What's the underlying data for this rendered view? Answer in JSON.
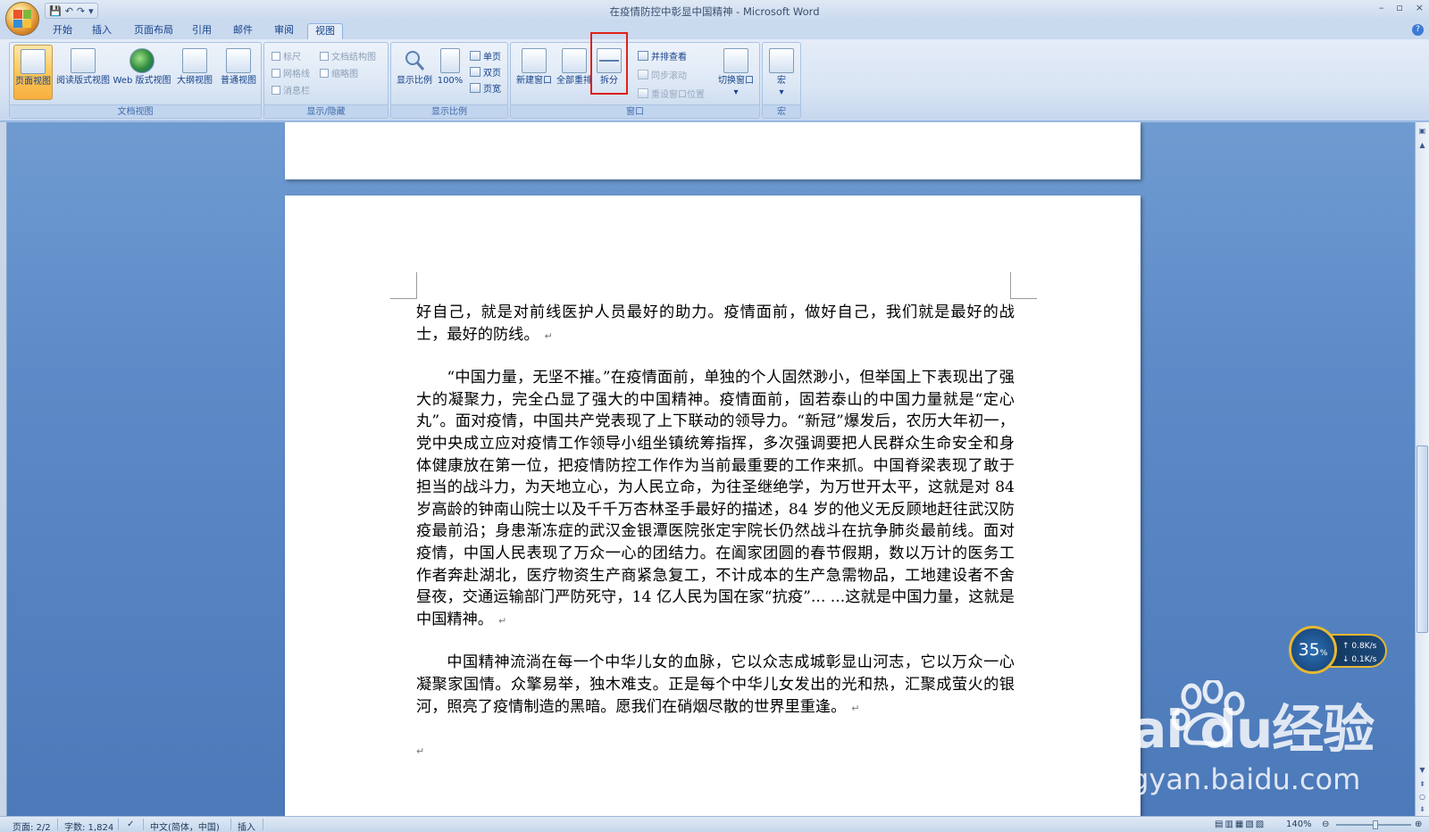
{
  "window": {
    "title": "在疫情防控中彰显中国精神 - Microsoft Word",
    "controls": [
      "–",
      "▫",
      "×"
    ]
  },
  "qat": {
    "save": "💾",
    "undo": "↶",
    "redo": "↷",
    "more": "▾"
  },
  "tabs": [
    {
      "label": "开始"
    },
    {
      "label": "插入"
    },
    {
      "label": "页面布局"
    },
    {
      "label": "引用"
    },
    {
      "label": "邮件"
    },
    {
      "label": "审阅"
    },
    {
      "label": "视图"
    }
  ],
  "ribbon": {
    "groups": {
      "doc_views": "文档视图",
      "show_hide": "显示/隐藏",
      "zoom": "显示比例",
      "window": "窗口",
      "macro": "宏"
    },
    "doc_views": {
      "page_view": "页面视图",
      "reading_view": "阅读版式视图",
      "web_view": "Web 版式视图",
      "outline_view": "大纲视图",
      "draft_view": "普通视图"
    },
    "show_hide": {
      "ruler": "标尺",
      "gridlines": "网格线",
      "message_bar": "消息栏",
      "doc_map": "文档结构图",
      "thumbnails": "缩略图"
    },
    "zoom": {
      "zoom": "显示比例",
      "hundred": "100%",
      "one_page": "单页",
      "two_pages": "双页",
      "page_width": "页宽"
    },
    "window": {
      "new_window": "新建窗口",
      "arrange_all": "全部重排",
      "split": "拆分",
      "side_by_side": "并排查看",
      "sync_scroll": "同步滚动",
      "reset_position": "重设窗口位置",
      "switch_windows": "切换窗口"
    },
    "macro": {
      "macros": "宏"
    }
  },
  "document": {
    "para1": "好自己，就是对前线医护人员最好的助力。疫情面前，做好自己，我们就是最好的战士，最好的防线。",
    "para2": "“中国力量，无坚不摧。”在疫情面前，单独的个人固然渺小，但举国上下表现出了强大的凝聚力，完全凸显了强大的中国精神。疫情面前，固若泰山的中国力量就是“定心丸”。面对疫情，中国共产党表现了上下联动的领导力。“新冠”爆发后，农历大年初一，党中央成立应对疫情工作领导小组坐镇统筹指挥，多次强调要把人民群众生命安全和身体健康放在第一位，把疫情防控工作作为当前最重要的工作来抓。中国脊梁表现了敢于担当的战斗力，为天地立心，为人民立命，为往圣继绝学，为万世开太平，这就是对 84 岁高龄的钟南山院士以及千千万杏林圣手最好的描述，84 岁的他义无反顾地赶往武汉防疫最前沿；身患渐冻症的武汉金银潭医院张定宇院长仍然战斗在抗争肺炎最前线。面对疫情，中国人民表现了万众一心的团结力。在阖家团圆的春节假期，数以万计的医务工作者奔赴湖北，医疗物资生产商紧急复工，不计成本的生产急需物品，工地建设者不舍昼夜，交通运输部门严防死守，14 亿人民为国在家“抗疫”... ...这就是中国力量，这就是中国精神。",
    "para3": "中国精神流淌在每一个中华儿女的血脉，它以众志成城彰显山河志，它以万众一心凝聚家国情。众擎易举，独木难支。正是每个中华儿女发出的光和热，汇聚成萤火的银河，照亮了疫情制造的黑暗。愿我们在硝烟尽散的世界里重逢。",
    "para_mark": "↵"
  },
  "status": {
    "page": "页面: 2/2",
    "words": "字数: 1,824",
    "language": "中文(简体，中国)",
    "mode": "插入",
    "zoom": "140%"
  },
  "net_widget": {
    "cpu": "35",
    "unit": "%",
    "up": "↑ 0.8K/s",
    "down": "↓ 0.1K/s"
  },
  "watermark": {
    "brand": "Bai  du经验",
    "url": "jingyan.baidu.com"
  },
  "colors": {
    "accent": "#15428b",
    "highlight": "#e0201c",
    "workspace": "#5d8bc8"
  }
}
